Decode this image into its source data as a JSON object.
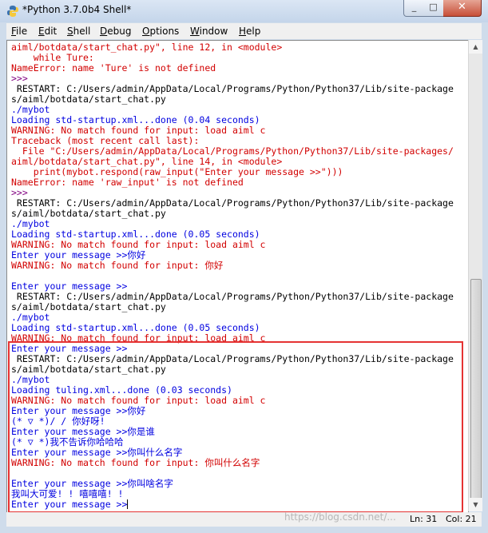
{
  "window": {
    "title": "*Python 3.7.0b4 Shell*",
    "controls": {
      "minimize": "_",
      "maximize": "□",
      "close": "✕"
    }
  },
  "menu": [
    {
      "label": "File",
      "accel": "F",
      "rest": "ile"
    },
    {
      "label": "Edit",
      "accel": "E",
      "rest": "dit"
    },
    {
      "label": "Shell",
      "accel": "S",
      "rest": "hell"
    },
    {
      "label": "Debug",
      "accel": "D",
      "rest": "ebug"
    },
    {
      "label": "Options",
      "accel": "O",
      "rest": "ptions"
    },
    {
      "label": "Window",
      "accel": "W",
      "rest": "indow"
    },
    {
      "label": "Help",
      "accel": "H",
      "rest": "elp"
    }
  ],
  "shell_lines": [
    {
      "text": "aiml/botdata/start_chat.py\", line 12, in <module>",
      "color": "red"
    },
    {
      "text": "    while Ture:",
      "color": "red"
    },
    {
      "text": "NameError: name 'Ture' is not defined",
      "color": "red"
    },
    {
      "text": ">>> ",
      "color": "purple"
    },
    {
      "text": " RESTART: C:/Users/admin/AppData/Local/Programs/Python/Python37/Lib/site-package",
      "color": "black"
    },
    {
      "text": "s/aiml/botdata/start_chat.py",
      "color": "black"
    },
    {
      "text": "./mybot",
      "color": "blue"
    },
    {
      "text": "Loading std-startup.xml...done (0.04 seconds)",
      "color": "blue"
    },
    {
      "text": "WARNING: No match found for input: load aiml c",
      "color": "red"
    },
    {
      "text": "Traceback (most recent call last):",
      "color": "red"
    },
    {
      "text": "  File \"C:/Users/admin/AppData/Local/Programs/Python/Python37/Lib/site-packages/",
      "color": "red"
    },
    {
      "text": "aiml/botdata/start_chat.py\", line 14, in <module>",
      "color": "red"
    },
    {
      "text": "    print(mybot.respond(raw_input(\"Enter your message >>\")))",
      "color": "red"
    },
    {
      "text": "NameError: name 'raw_input' is not defined",
      "color": "red"
    },
    {
      "text": ">>> ",
      "color": "purple"
    },
    {
      "text": " RESTART: C:/Users/admin/AppData/Local/Programs/Python/Python37/Lib/site-package",
      "color": "black"
    },
    {
      "text": "s/aiml/botdata/start_chat.py",
      "color": "black"
    },
    {
      "text": "./mybot",
      "color": "blue"
    },
    {
      "text": "Loading std-startup.xml...done (0.05 seconds)",
      "color": "blue"
    },
    {
      "text": "WARNING: No match found for input: load aiml c",
      "color": "red"
    },
    {
      "text": "Enter your message >>你好",
      "color": "blue"
    },
    {
      "text": "WARNING: No match found for input: 你好",
      "color": "red"
    },
    {
      "text": "",
      "color": "black"
    },
    {
      "text": "Enter your message >>",
      "color": "blue"
    },
    {
      "text": " RESTART: C:/Users/admin/AppData/Local/Programs/Python/Python37/Lib/site-package",
      "color": "black"
    },
    {
      "text": "s/aiml/botdata/start_chat.py",
      "color": "black"
    },
    {
      "text": "./mybot",
      "color": "blue"
    },
    {
      "text": "Loading std-startup.xml...done (0.05 seconds)",
      "color": "blue"
    },
    {
      "text": "WARNING: No match found for input: load aiml c",
      "color": "red"
    },
    {
      "text": "Enter your message >>",
      "color": "blue"
    },
    {
      "text": " RESTART: C:/Users/admin/AppData/Local/Programs/Python/Python37/Lib/site-package",
      "color": "black"
    },
    {
      "text": "s/aiml/botdata/start_chat.py",
      "color": "black"
    },
    {
      "text": "./mybot",
      "color": "blue"
    },
    {
      "text": "Loading tuling.xml...done (0.03 seconds)",
      "color": "blue"
    },
    {
      "text": "WARNING: No match found for input: load aiml c",
      "color": "red"
    },
    {
      "text": "Enter your message >>你好",
      "color": "blue"
    },
    {
      "text": "(* ▽ *)/ / 你好呀!",
      "color": "blue"
    },
    {
      "text": "Enter your message >>你是谁",
      "color": "blue"
    },
    {
      "text": "(* ▽ *)我不告诉你哈哈哈",
      "color": "blue"
    },
    {
      "text": "Enter your message >>你叫什么名字",
      "color": "blue"
    },
    {
      "text": "WARNING: No match found for input: 你叫什么名字",
      "color": "red"
    },
    {
      "text": "",
      "color": "black"
    },
    {
      "text": "Enter your message >>你叫啥名字",
      "color": "blue"
    },
    {
      "text": "我叫大可爱! ! 嘻嘻嘻! !",
      "color": "blue"
    },
    {
      "text": "Enter your message >>",
      "color": "blue"
    }
  ],
  "status": {
    "line": "Ln: 31",
    "col": "Col: 21",
    "watermark": "https://blog.csdn.net/..."
  },
  "colors": {
    "error": "#d20000",
    "output": "#0000e0",
    "prompt": "#800080",
    "highlight_box": "#e53333"
  }
}
